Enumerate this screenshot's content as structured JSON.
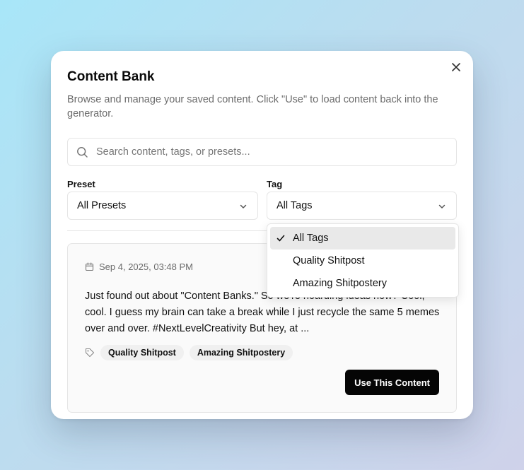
{
  "dialog": {
    "title": "Content Bank",
    "description": "Browse and manage your saved content. Click \"Use\" to load content back into the generator.",
    "close_icon": "x-icon"
  },
  "search": {
    "placeholder": "Search content, tags, or presets...",
    "value": "",
    "icon": "search-icon"
  },
  "filters": {
    "preset": {
      "label": "Preset",
      "value": "All Presets"
    },
    "tag": {
      "label": "Tag",
      "value": "All Tags"
    }
  },
  "tag_menu": {
    "items": [
      {
        "label": "All Tags",
        "selected": true
      },
      {
        "label": "Quality Shitpost",
        "selected": false
      },
      {
        "label": "Amazing Shitpostery",
        "selected": false
      }
    ]
  },
  "items": [
    {
      "date": "Sep 4, 2025, 03:48 PM",
      "text": "Just found out about \"Content Banks.\" So we're hoarding ideas now? Cool, cool. I guess my brain can take a break while I just recycle the same 5 memes over and over. #NextLevelCreativity But hey, at ...",
      "tags": [
        "Quality Shitpost",
        "Amazing Shitpostery"
      ],
      "use_button": "Use This Content"
    }
  ],
  "colors": {
    "primary_button": "#050505",
    "selected_menu_item": "#e9e9e9",
    "muted_text": "#6b6b6b"
  }
}
